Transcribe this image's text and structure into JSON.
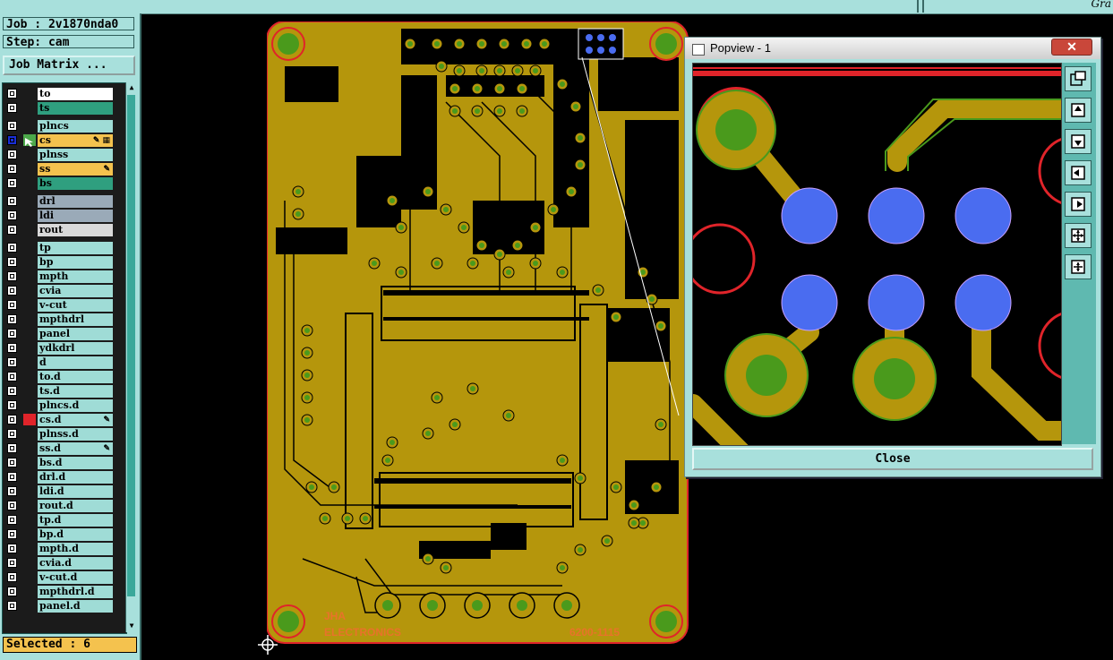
{
  "top": {
    "corner_text": "Gra"
  },
  "job": {
    "job_label": "Job : 2v1870nda0",
    "step_label": "Step: cam",
    "matrix_button": "Job Matrix ..."
  },
  "layers": [
    {
      "name": "to",
      "color": "#ffffff"
    },
    {
      "name": "ts",
      "color": "#2f9f7f"
    },
    {
      "name": "plncs",
      "color": "#9fdcd6"
    },
    {
      "name": "cs",
      "color": "#f4c24e",
      "tag": "✎ ▦",
      "active": true
    },
    {
      "name": "plnss",
      "color": "#9fdcd6"
    },
    {
      "name": "ss",
      "color": "#f4c24e",
      "tag": "✎"
    },
    {
      "name": "bs",
      "color": "#2f9f7f"
    },
    {
      "name": "drl",
      "color": "#9aaab8"
    },
    {
      "name": "ldi",
      "color": "#9aaab8"
    },
    {
      "name": "rout",
      "color": "#d9d9d9"
    },
    {
      "name": "tp",
      "color": "#9fdcd6"
    },
    {
      "name": "bp",
      "color": "#9fdcd6"
    },
    {
      "name": "mpth",
      "color": "#9fdcd6"
    },
    {
      "name": "cvia",
      "color": "#9fdcd6"
    },
    {
      "name": "v-cut",
      "color": "#9fdcd6"
    },
    {
      "name": "mpthdrl",
      "color": "#9fdcd6"
    },
    {
      "name": "panel",
      "color": "#9fdcd6"
    },
    {
      "name": "ydkdrl",
      "color": "#9fdcd6"
    },
    {
      "name": "d",
      "color": "#9fdcd6"
    },
    {
      "name": "to.d",
      "color": "#9fdcd6"
    },
    {
      "name": "ts.d",
      "color": "#9fdcd6"
    },
    {
      "name": "plncs.d",
      "color": "#9fdcd6"
    },
    {
      "name": "cs.d",
      "color": "#9fdcd6",
      "tag": "✎",
      "red": true
    },
    {
      "name": "plnss.d",
      "color": "#9fdcd6"
    },
    {
      "name": "ss.d",
      "color": "#9fdcd6",
      "tag": "✎"
    },
    {
      "name": "bs.d",
      "color": "#9fdcd6"
    },
    {
      "name": "drl.d",
      "color": "#9fdcd6"
    },
    {
      "name": "ldi.d",
      "color": "#9fdcd6"
    },
    {
      "name": "rout.d",
      "color": "#9fdcd6"
    },
    {
      "name": "tp.d",
      "color": "#9fdcd6"
    },
    {
      "name": "bp.d",
      "color": "#9fdcd6"
    },
    {
      "name": "mpth.d",
      "color": "#9fdcd6"
    },
    {
      "name": "cvia.d",
      "color": "#9fdcd6"
    },
    {
      "name": "v-cut.d",
      "color": "#9fdcd6"
    },
    {
      "name": "mpthdrl.d",
      "color": "#9fdcd6"
    },
    {
      "name": "panel.d",
      "color": "#9fdcd6"
    }
  ],
  "status": {
    "selected": "Selected : 6"
  },
  "board": {
    "silk_line1": "JHA",
    "silk_line2": "ELECTRONICS",
    "part_number": "6200-1115",
    "copper_color": "#b5960c",
    "pad_color": "#4a9a1c",
    "edge_color": "#e0242a"
  },
  "popview": {
    "title": "Popview - 1",
    "close_x": "✕",
    "close_button": "Close",
    "toolbar_icons": [
      "zoom-window-icon",
      "pan-up-icon",
      "pan-down-icon",
      "pan-left-icon",
      "pan-right-icon",
      "zoom-fit-icon",
      "zoom-home-icon"
    ]
  }
}
